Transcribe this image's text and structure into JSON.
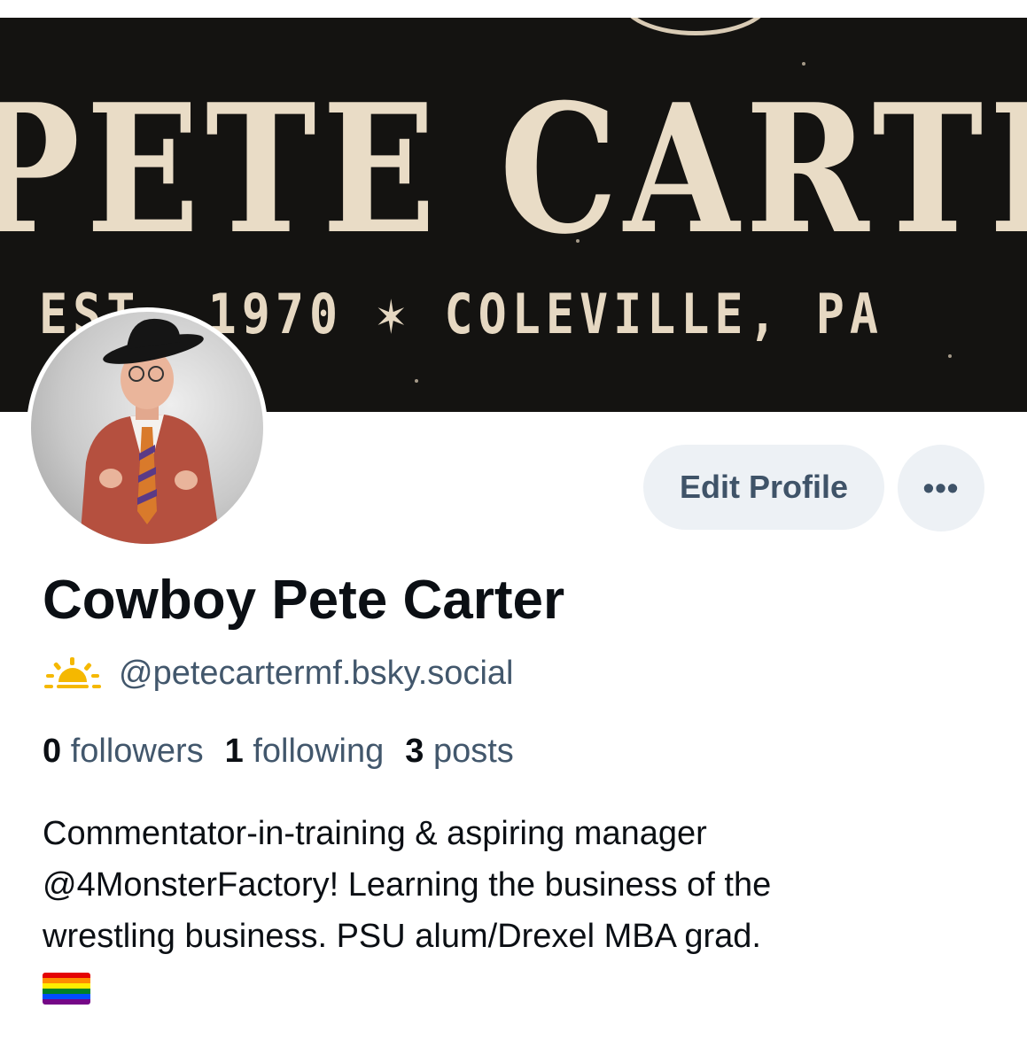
{
  "banner": {
    "title": "PETE CARTER",
    "subtitle": "EST. 1970 ✶ COLEVILLE, PA"
  },
  "profile": {
    "display_name": "Cowboy Pete Carter",
    "handle": "@petecartermf.bsky.social",
    "handle_icon": "sunrise-icon",
    "edit_button_label": "Edit Profile",
    "more_button_label": "•••"
  },
  "stats": {
    "followers_count": "0",
    "followers_label": "followers",
    "following_count": "1",
    "following_label": "following",
    "posts_count": "3",
    "posts_label": "posts"
  },
  "bio": {
    "line1": "Commentator-in-training & aspiring manager",
    "line2": "@4MonsterFactory! Learning the business of the",
    "line3": "wrestling business. PSU alum/Drexel MBA grad.",
    "emoji": "rainbow-flag-icon"
  },
  "colors": {
    "banner_bg": "#141311",
    "banner_text": "#e9dcc6",
    "button_bg": "#edf1f5",
    "button_text": "#3f5368",
    "secondary_text": "#42576c",
    "primary_text": "#0b0f14",
    "sun_icon": "#f5b800"
  }
}
